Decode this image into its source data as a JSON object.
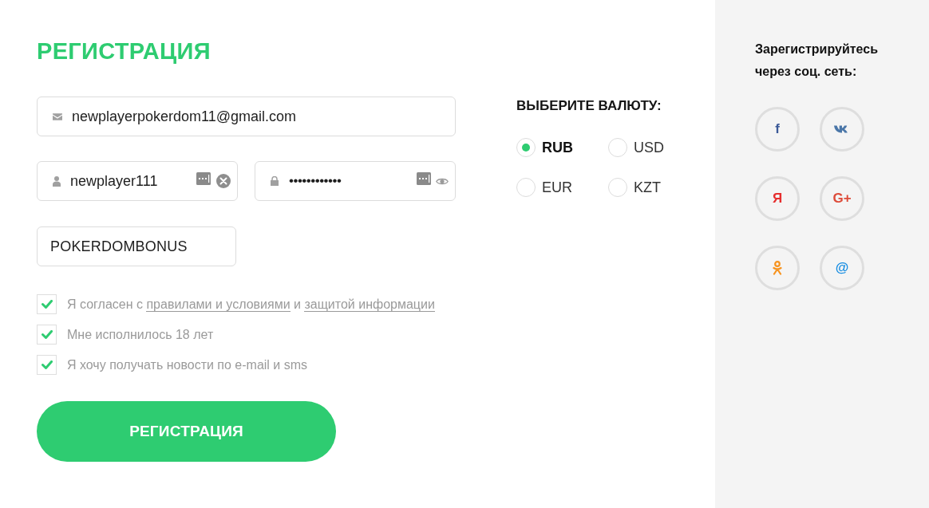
{
  "form": {
    "title": "РЕГИСТРАЦИЯ",
    "email": {
      "value": "newplayerpokerdom11@gmail.com"
    },
    "username": {
      "value": "newplayer111"
    },
    "password": {
      "value": "••••••••••••"
    },
    "promo_code": {
      "value": "POKERDOMBONUS"
    },
    "agreements": [
      {
        "checked": true,
        "segments": [
          {
            "kind": "text",
            "text": "Я согласен с"
          },
          {
            "kind": "link",
            "text": "правилами и условиями"
          },
          {
            "kind": "text",
            "text": "и"
          },
          {
            "kind": "link",
            "text": "защитой информации"
          }
        ]
      },
      {
        "checked": true,
        "segments": [
          {
            "kind": "text",
            "text": "Мне исполнилось 18 лет"
          }
        ]
      },
      {
        "checked": true,
        "segments": [
          {
            "kind": "text",
            "text": "Я хочу получать новости по e-mail и sms"
          }
        ]
      }
    ],
    "submit_button": "РЕГИСТРАЦИЯ"
  },
  "currency": {
    "title": "ВЫБЕРИТЕ ВАЛЮТУ:",
    "options": [
      {
        "label": "RUB",
        "selected": true
      },
      {
        "label": "USD",
        "selected": false
      },
      {
        "label": "EUR",
        "selected": false
      },
      {
        "label": "KZT",
        "selected": false
      }
    ]
  },
  "social": {
    "title": "Зарегистрируйтесь через соц. сеть:",
    "buttons": [
      {
        "kind": "glyph",
        "glyph": "f",
        "color": "#3b5998"
      },
      {
        "kind": "vk",
        "color": "#4a76a8"
      },
      {
        "kind": "glyph",
        "glyph": "Я",
        "color": "#e62e2e"
      },
      {
        "kind": "glyph",
        "glyph": "G+",
        "color": "#dd4b39"
      },
      {
        "kind": "ok",
        "color": "#f7931e"
      },
      {
        "kind": "glyph",
        "glyph": "@",
        "color": "#168de2"
      }
    ]
  }
}
